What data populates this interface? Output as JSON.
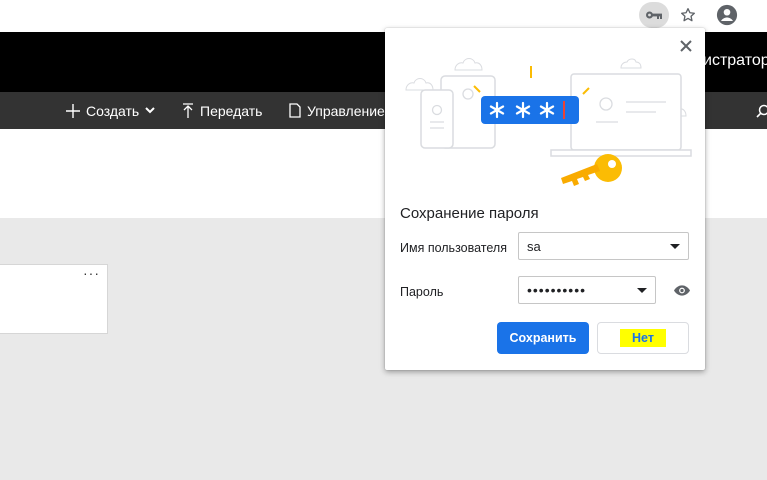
{
  "browser": {
    "icons": [
      "key-icon",
      "star-icon",
      "profile-icon"
    ]
  },
  "app": {
    "user_label": "истратор",
    "toolbar": {
      "create_label": "Создать",
      "share_label": "Передать",
      "manage_label": "Управление"
    },
    "card": {
      "more_label": "···"
    }
  },
  "popup": {
    "title": "Сохранение пароля",
    "username_label": "Имя пользователя",
    "username_value": "sa",
    "password_label": "Пароль",
    "password_value": "••••••••••",
    "save_button": "Сохранить",
    "no_button": "Нет",
    "illustration_mask": "* * *"
  },
  "colors": {
    "primary": "#1a73e8",
    "highlight": "#ffff00",
    "key_yellow": "#fbbc04"
  }
}
